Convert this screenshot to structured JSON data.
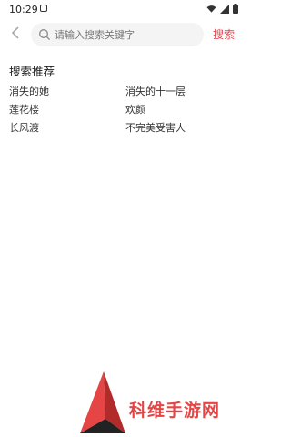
{
  "status_bar": {
    "time": "10:29",
    "icons": [
      "notification-icon",
      "wifi-icon",
      "signal-icon",
      "battery-icon"
    ]
  },
  "search": {
    "placeholder": "请输入搜索关键字",
    "value": "",
    "button_label": "搜索"
  },
  "recommend": {
    "title": "搜索推荐",
    "items": [
      {
        "label": "消失的她"
      },
      {
        "label": "消失的十一层"
      },
      {
        "label": "莲花楼"
      },
      {
        "label": "欢颜"
      },
      {
        "label": "长风渡"
      },
      {
        "label": "不完美受害人"
      }
    ]
  },
  "watermark": {
    "text": "科维手游网"
  },
  "colors": {
    "accent": "#e8434a",
    "watermark_red": "#e64545"
  }
}
